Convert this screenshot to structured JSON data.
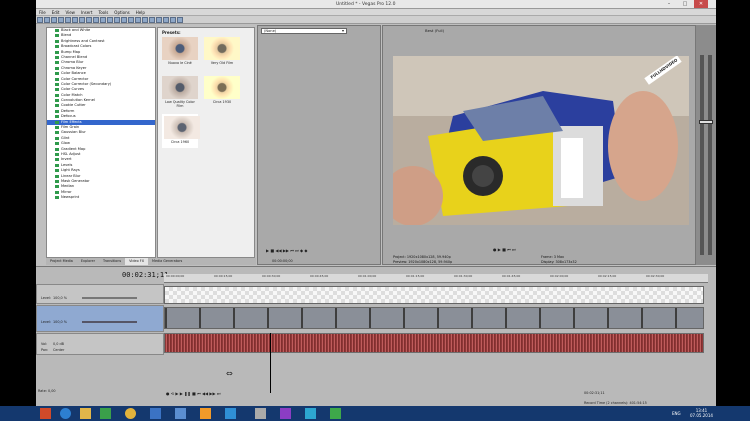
{
  "app": {
    "title": "Untitled * - Vegas Pro 12.0"
  },
  "window_controls": {
    "minimize": "–",
    "maximize": "□",
    "close": "✕"
  },
  "menu": [
    "File",
    "Edit",
    "View",
    "Insert",
    "Tools",
    "Options",
    "Help"
  ],
  "effects": [
    "Black and White",
    "Blend",
    "Brightness and Contrast",
    "Broadcast Colors",
    "Bump Map",
    "Channel Blend",
    "Chroma Blur",
    "Chroma Keyer",
    "Color Balance",
    "Color Corrector",
    "Color Corrector (Secondary)",
    "Color Curves",
    "Color Match",
    "Convolution Kernel",
    "Cookie Cutter",
    "Deform",
    "Defocus",
    "Film Effects",
    "Film Grain",
    "Gaussian Blur",
    "Glint",
    "Glow",
    "Gradient Map",
    "HSL Adjust",
    "Invert",
    "Levels",
    "Light Rays",
    "Linear Blur",
    "Mask Generator",
    "Median",
    "Mirror",
    "Newsprint"
  ],
  "selected_effect": "Film Effects",
  "presets": {
    "heading": "Presets:",
    "items": [
      "Nuovo le Ciné",
      "Very Old Film",
      "Low Quality Color Film",
      "Circa 1930",
      "Circa 1960"
    ]
  },
  "left_tabs": [
    "Project Media",
    "Explorer",
    "Transitions",
    "Video FX",
    "Media Generators"
  ],
  "active_left_tab": "Video FX",
  "trimmer": {
    "dropdown": "(None)",
    "timecode": "00:00:00;00"
  },
  "preview": {
    "mode": "Best (Full)",
    "project_info": "Project:  1920x1080x128, 59.940p",
    "preview_info": "Preview:  1920x1080x128, 59.940p",
    "frame": "Frame:  3 Max",
    "display": "Display:  308x173x32",
    "watermark": "FULLHDVIDEO"
  },
  "timeline": {
    "timecode": "00:02:31;11",
    "ruler_ticks": [
      "00:00:00;00",
      "00:00:15;00",
      "00:00:30;00",
      "00:00:45;00",
      "00:01:00;00",
      "00:01:15;00",
      "00:01:30;00",
      "00:01:45;00",
      "00:02:00;00",
      "00:02:15;00",
      "00:02:30;00"
    ],
    "tracks": [
      {
        "level_label": "Level:",
        "level": "100,0 %"
      },
      {
        "level_label": "Level:",
        "level": "100,0 %"
      },
      {
        "vol_label": "Vol:",
        "vol": "0,0 dB",
        "pan_label": "Pan:",
        "pan": "Center"
      }
    ],
    "rate": "Rate: 0,00",
    "end_time": "00:02:31;11",
    "record_time": "Record Time (2 channels): 401:54:15"
  },
  "taskbar": {
    "lang": "ENG",
    "time": "13:41",
    "date": "07.05.2014"
  }
}
